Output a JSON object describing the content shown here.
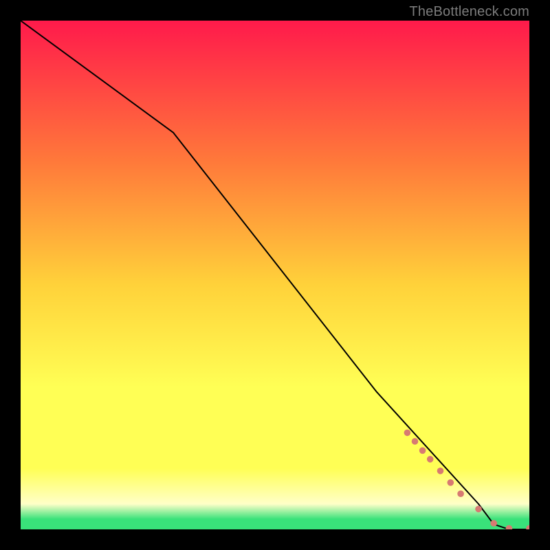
{
  "attribution": "TheBottleneck.com",
  "colors": {
    "bg": "#000000",
    "gradient_top": "#ff1a4b",
    "gradient_mid1": "#ff7a3a",
    "gradient_mid2": "#ffd23a",
    "gradient_mid3": "#ffff55",
    "gradient_pale": "#ffffc8",
    "gradient_green": "#39e27a",
    "line": "#000000",
    "marker": "#d77a72"
  },
  "chart_data": {
    "type": "line",
    "title": "",
    "xlabel": "",
    "ylabel": "",
    "xlim": [
      0,
      100
    ],
    "ylim": [
      0,
      100
    ],
    "series": [
      {
        "name": "curve",
        "x": [
          0,
          30,
          70,
          90,
          93,
          96,
          100
        ],
        "y": [
          100,
          78,
          27,
          5,
          1,
          0,
          0
        ]
      }
    ],
    "markers": {
      "name": "highlighted-points",
      "x": [
        76,
        77.5,
        79,
        80.5,
        82.5,
        84.5,
        86.5,
        90,
        93,
        96,
        100
      ],
      "y": [
        19,
        17.3,
        15.5,
        13.8,
        11.5,
        9.2,
        7.0,
        4.0,
        1.2,
        0.2,
        0.2
      ]
    },
    "marker_radius_pct": 0.65
  }
}
